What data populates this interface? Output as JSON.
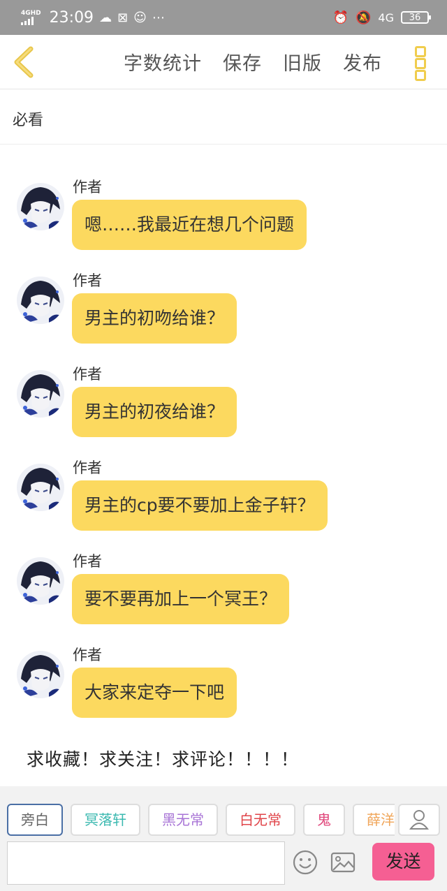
{
  "status_bar": {
    "network": "4GHD",
    "time": "23:09",
    "sim": "4G",
    "battery": "36",
    "icons": [
      "signal-icon",
      "cloud-icon",
      "sim-off-icon",
      "chat-icon",
      "more-icon",
      "alarm-icon",
      "mute-bell-icon",
      "battery-icon"
    ]
  },
  "nav": {
    "back_icon": "chevron-left-icon",
    "word_count": "字数统计",
    "save": "保存",
    "old_version": "旧版",
    "publish": "发布",
    "menu_icon": "vertical-dots-icon",
    "accent": "#f0cd4e"
  },
  "chapter_title": "必看",
  "messages": [
    {
      "name": "作者",
      "text": "嗯……我最近在想几个问题"
    },
    {
      "name": "作者",
      "text": "男主的初吻给谁？"
    },
    {
      "name": "作者",
      "text": "男主的初夜给谁？"
    },
    {
      "name": "作者",
      "text": "男主的cp要不要加上金子轩？"
    },
    {
      "name": "作者",
      "text": "要不要再加上一个冥王？"
    },
    {
      "name": "作者",
      "text": "大家来定夺一下吧"
    }
  ],
  "bubble_color": "#fcd95f",
  "outro": "求收藏！求关注！求评论！！！！",
  "characters": [
    {
      "label": "旁白",
      "color": "#666666"
    },
    {
      "label": "冥落轩",
      "color": "#3bb9b0"
    },
    {
      "label": "黑无常",
      "color": "#a874d6"
    },
    {
      "label": "白无常",
      "color": "#e0454a"
    },
    {
      "label": "鬼",
      "color": "#e0457a"
    },
    {
      "label": "薛洋",
      "color": "#f0a65a"
    }
  ],
  "input": {
    "placeholder": ""
  },
  "send_label": "发送",
  "send_color": "#f55f93"
}
